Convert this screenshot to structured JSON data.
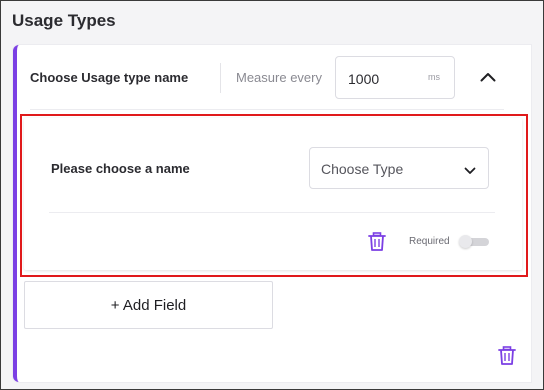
{
  "section": {
    "title": "Usage Types"
  },
  "usage_type": {
    "name": "Choose Usage type name",
    "measure_label": "Measure every",
    "measure_value": "1000",
    "measure_unit": "ms",
    "collapse_icon": "chevron-up-icon"
  },
  "field": {
    "name": "Please choose a name",
    "type_select": {
      "value": "Choose Type",
      "icon": "chevron-down-icon"
    },
    "delete_icon": "trash-icon",
    "required_label": "Required",
    "required": false
  },
  "add_field_label": "+ Add Field",
  "delete_usage_type_icon": "trash-icon",
  "colors": {
    "accent": "#7b3fe4",
    "highlight": "#e0191b",
    "trash": "#7b3fe4"
  }
}
